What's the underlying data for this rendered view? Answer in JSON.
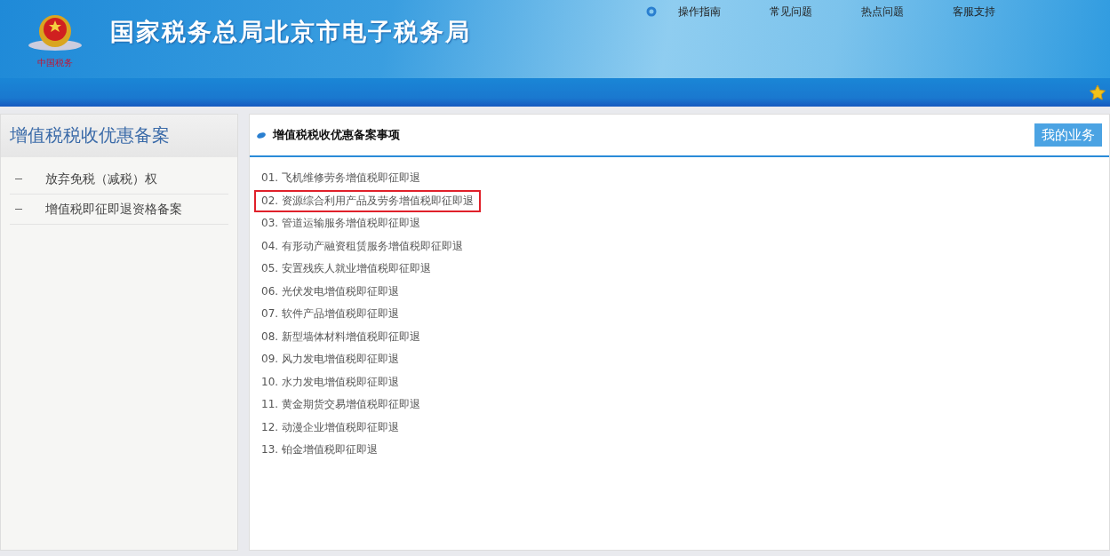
{
  "header": {
    "site_title": "国家税务总局北京市电子税务局",
    "logo_caption": "中国税务",
    "top_links": [
      "操作指南",
      "常见问题",
      "热点问题",
      "客服支持"
    ]
  },
  "sidebar": {
    "title": "增值税税收优惠备案",
    "items": [
      {
        "label": "放弃免税（减税）权"
      },
      {
        "label": "增值税即征即退资格备案"
      }
    ]
  },
  "main": {
    "title": "增值税税收优惠备案事项",
    "my_business_button": "我的业务",
    "items": [
      {
        "label": "01. 飞机维修劳务增值税即征即退",
        "highlighted": false
      },
      {
        "label": "02. 资源综合利用产品及劳务增值税即征即退",
        "highlighted": true
      },
      {
        "label": "03. 管道运输服务增值税即征即退",
        "highlighted": false
      },
      {
        "label": "04. 有形动产融资租赁服务增值税即征即退",
        "highlighted": false
      },
      {
        "label": "05. 安置残疾人就业增值税即征即退",
        "highlighted": false
      },
      {
        "label": "06. 光伏发电增值税即征即退",
        "highlighted": false
      },
      {
        "label": "07. 软件产品增值税即征即退",
        "highlighted": false
      },
      {
        "label": "08. 新型墙体材料增值税即征即退",
        "highlighted": false
      },
      {
        "label": "09. 风力发电增值税即征即退",
        "highlighted": false
      },
      {
        "label": "10. 水力发电增值税即征即退",
        "highlighted": false
      },
      {
        "label": "11. 黄金期货交易增值税即征即退",
        "highlighted": false
      },
      {
        "label": "12. 动漫企业增值税即征即退",
        "highlighted": false
      },
      {
        "label": "13. 铂金增值税即征即退",
        "highlighted": false
      }
    ]
  }
}
